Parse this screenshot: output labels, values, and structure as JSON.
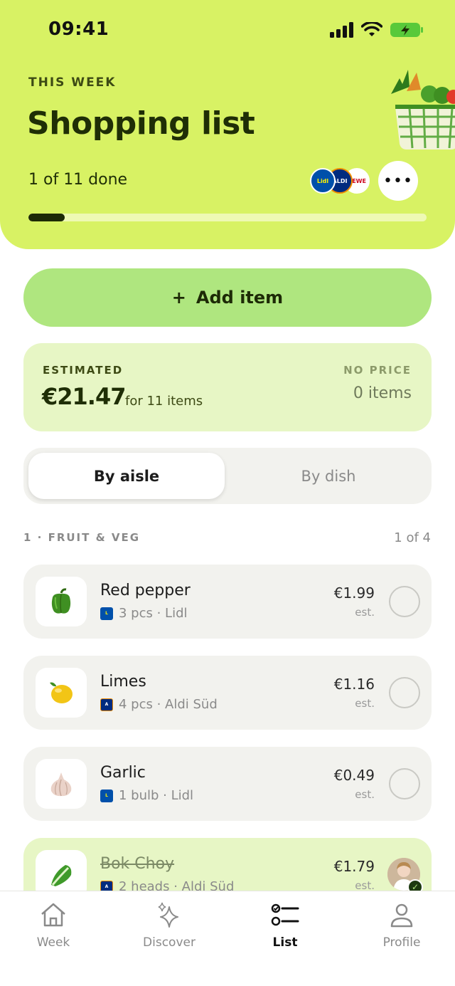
{
  "status_bar": {
    "time": "09:41"
  },
  "header": {
    "eyebrow": "THIS WEEK",
    "title": "Shopping list",
    "progress_text": "1 of 11 done",
    "progress_fraction": 0.0909,
    "stores": [
      "Lidl",
      "ALDI",
      "REWE"
    ],
    "more_icon": "more-horizontal-icon"
  },
  "add_button": {
    "plus": "+",
    "label": "Add item"
  },
  "estimate": {
    "label": "ESTIMATED",
    "value": "€21.47",
    "sub": "for 11 items",
    "no_price_label": "NO PRICE",
    "no_price_value": "0 items"
  },
  "segment": {
    "active": "By aisle",
    "inactive": "By dish"
  },
  "section": {
    "title": "1 · FRUIT & VEG",
    "count": "1 of 4"
  },
  "items": [
    {
      "name": "Red pepper",
      "meta": "3 pcs · Lidl",
      "store": "Lidl",
      "price": "€1.99",
      "est": "est.",
      "done": false,
      "icon": "pepper-icon"
    },
    {
      "name": "Limes",
      "meta": "4 pcs · Aldi Süd",
      "store": "ALDI",
      "price": "€1.16",
      "est": "est.",
      "done": false,
      "icon": "lime-icon"
    },
    {
      "name": "Garlic",
      "meta": "1 bulb · Lidl",
      "store": "Lidl",
      "price": "€0.49",
      "est": "est.",
      "done": false,
      "icon": "garlic-icon"
    },
    {
      "name": "Bok Choy",
      "meta": "2 heads · Aldi Süd",
      "store": "ALDI",
      "price": "€1.79",
      "est": "est.",
      "done": true,
      "icon": "bok-choy-icon"
    }
  ],
  "tabs": [
    {
      "label": "Week",
      "icon": "home-icon",
      "active": false
    },
    {
      "label": "Discover",
      "icon": "sparkle-icon",
      "active": false
    },
    {
      "label": "List",
      "icon": "checklist-icon",
      "active": true
    },
    {
      "label": "Profile",
      "icon": "person-icon",
      "active": false
    }
  ],
  "colors": {
    "header_bg": "#d8f264",
    "accent_green": "#afe67f",
    "card_green": "#e7f6c5",
    "dark": "#1d2a06"
  }
}
